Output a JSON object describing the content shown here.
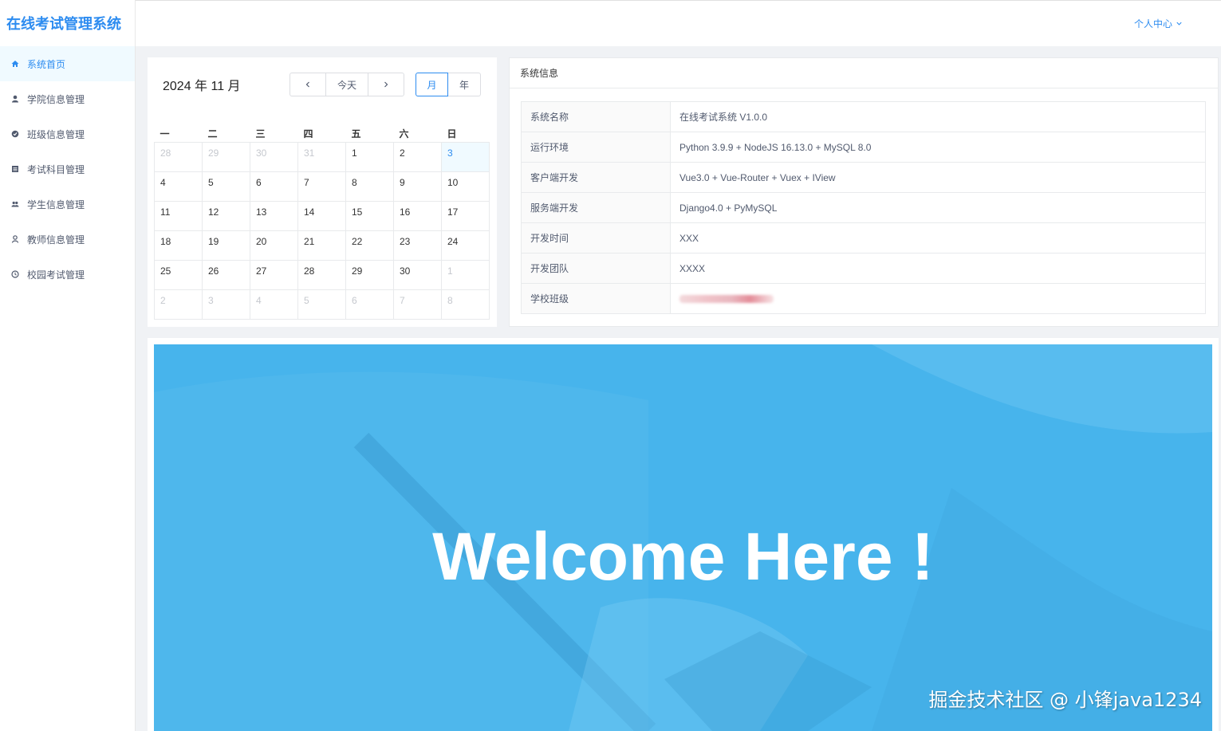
{
  "app": {
    "title": "在线考试管理系统"
  },
  "header": {
    "user_center": "个人中心"
  },
  "sidebar": {
    "items": [
      {
        "label": "系统首页",
        "icon": "home-icon",
        "active": true
      },
      {
        "label": "学院信息管理",
        "icon": "user-icon",
        "active": false
      },
      {
        "label": "班级信息管理",
        "icon": "circle-icon",
        "active": false
      },
      {
        "label": "考试科目管理",
        "icon": "document-icon",
        "active": false
      },
      {
        "label": "学生信息管理",
        "icon": "users-icon",
        "active": false
      },
      {
        "label": "教师信息管理",
        "icon": "teacher-icon",
        "active": false
      },
      {
        "label": "校园考试管理",
        "icon": "clock-icon",
        "active": false
      }
    ]
  },
  "calendar": {
    "title": "2024 年 11 月",
    "today_label": "今天",
    "month_label": "月",
    "year_label": "年",
    "weekdays": [
      "一",
      "二",
      "三",
      "四",
      "五",
      "六",
      "日"
    ],
    "weeks": [
      [
        "28",
        "29",
        "30",
        "31",
        "1",
        "2",
        "3"
      ],
      [
        "4",
        "5",
        "6",
        "7",
        "8",
        "9",
        "10"
      ],
      [
        "11",
        "12",
        "13",
        "14",
        "15",
        "16",
        "17"
      ],
      [
        "18",
        "19",
        "20",
        "21",
        "22",
        "23",
        "24"
      ],
      [
        "25",
        "26",
        "27",
        "28",
        "29",
        "30",
        "1"
      ],
      [
        "2",
        "3",
        "4",
        "5",
        "6",
        "7",
        "8"
      ]
    ]
  },
  "system_info": {
    "title": "系统信息",
    "rows": [
      {
        "key": "系统名称",
        "value": "在线考试系统 V1.0.0"
      },
      {
        "key": "运行环境",
        "value": "Python 3.9.9 + NodeJS 16.13.0 + MySQL 8.0"
      },
      {
        "key": "客户端开发",
        "value": "Vue3.0 + Vue-Router + Vuex + IView"
      },
      {
        "key": "服务端开发",
        "value": "Django4.0 + PyMySQL"
      },
      {
        "key": "开发时间",
        "value": "XXX"
      },
      {
        "key": "开发团队",
        "value": "XXXX"
      },
      {
        "key": "学校班级",
        "value": ""
      }
    ]
  },
  "banner": {
    "welcome": "Welcome Here !",
    "color": "#47b4ec"
  },
  "watermark": "掘金技术社区 @ 小锋java1234",
  "colors": {
    "accent": "#2d8cf0"
  }
}
